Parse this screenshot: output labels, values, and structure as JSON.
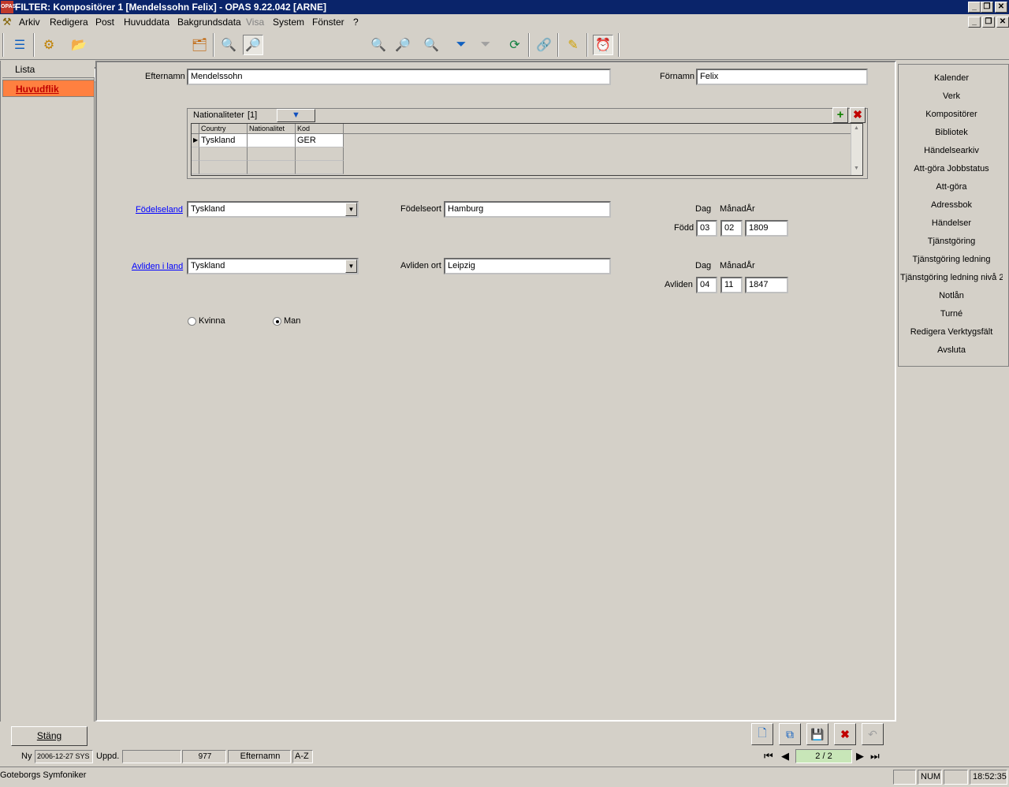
{
  "window": {
    "title": "FILTER: Kompositörer  1 [Mendelssohn Felix] - OPAS 9.22.042  [ARNE]",
    "app_icon_text": "OPAS"
  },
  "menu": [
    "Arkiv",
    "Redigera",
    "Post",
    "Huvuddata",
    "Bakgrundsdata",
    "Visa",
    "System",
    "Fönster",
    "?"
  ],
  "left_tabs": {
    "lista": "Lista",
    "huvudflik": "Huvudflik"
  },
  "form": {
    "efternamn_label": "Efternamn",
    "efternamn_value": "Mendelssohn",
    "fornamn_label": "Förnamn",
    "fornamn_value": "Felix",
    "nationaliteter_label": "Nationaliteter",
    "nationaliteter_count": "[1]",
    "grid_headers": [
      "Country",
      "Nationalitet",
      "Kod"
    ],
    "grid_row": {
      "country": "Tyskland",
      "nationalitet": "",
      "kod": "GER"
    },
    "fodelseland_label": "Födelseland",
    "fodelseland_value": "Tyskland",
    "fodelseort_label": "Födelseort",
    "fodelseort_value": "Hamburg",
    "dag_label": "Dag",
    "manad_ar_label": "MånadÅr",
    "fodd_label": "Född",
    "fodd_dag": "03",
    "fodd_manad": "02",
    "fodd_ar": "1809",
    "avliden_land_label": "Avliden i land",
    "avliden_land_value": "Tyskland",
    "avliden_ort_label": "Avliden ort",
    "avliden_ort_value": "Leipzig",
    "avliden_label": "Avliden",
    "avliden_dag": "04",
    "avliden_manad": "11",
    "avliden_ar": "1847",
    "kvinna_label": "Kvinna",
    "man_label": "Man",
    "gender_selected": "Man"
  },
  "right_links": [
    "Kalender",
    "Verk",
    "Kompositörer",
    "Bibliotek",
    "Händelsearkiv",
    "Att-göra Jobbstatus",
    "Att-göra",
    "Adressbok",
    "Händelser",
    "Tjänstgöring",
    "Tjänstgöring ledning",
    "Tjänstgöring ledning nivå 2",
    "Notlån",
    "Turné",
    "Redigera Verktygsfält",
    "Avsluta"
  ],
  "bottom": {
    "stang": "Stäng",
    "ny_label": "Ny",
    "ny_value": "2006-12-27 SYS",
    "uppd_label": "Uppd.",
    "uppd_value": "",
    "record_id": "977",
    "sort_field": "Efternamn",
    "sort_order": "A-Z",
    "nav_position": "2 / 2"
  },
  "status": {
    "organization": "Goteborgs Symfoniker",
    "num": "NUM",
    "time": "18:52:35"
  },
  "colors": {
    "titlebar": "#0a246a",
    "active_tab": "#ff8040",
    "link": "#0000ff"
  }
}
